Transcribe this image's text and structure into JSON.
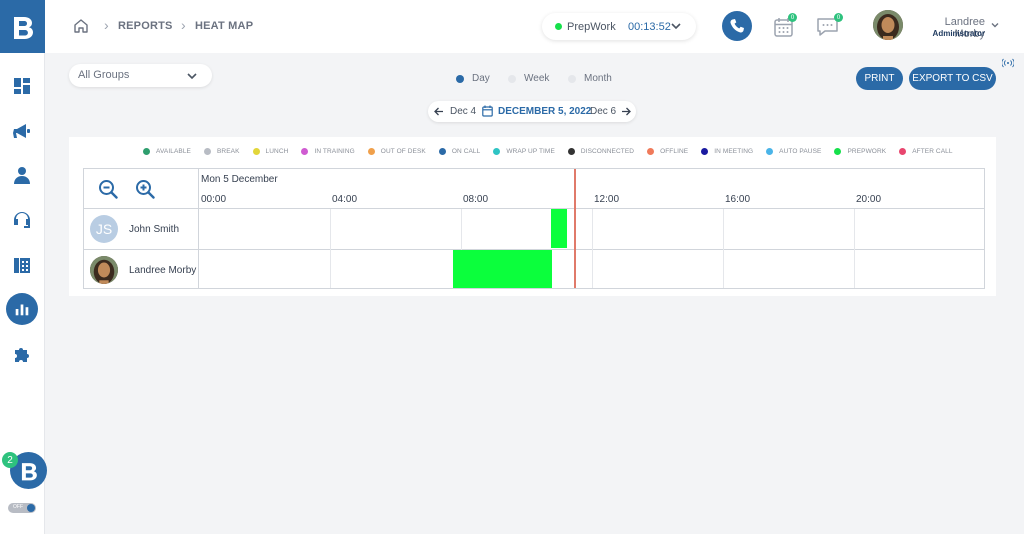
{
  "breadcrumb": {
    "items": [
      "REPORTS",
      "HEAT MAP"
    ]
  },
  "status": {
    "label": "PrepWork",
    "timer": "00:13:52",
    "color": "#16e04b"
  },
  "header": {
    "calendar_badge": "0",
    "chat_badge": "0",
    "user": {
      "name": "Landree Morby",
      "role": "Administrator"
    }
  },
  "sidebar": {
    "items": [
      "dashboard",
      "campaigns",
      "agents",
      "support",
      "phone-book",
      "reports",
      "integrations"
    ],
    "notification_count": "2",
    "toggle_label": "OFF"
  },
  "toolbar": {
    "group_select": "All Groups",
    "views": [
      {
        "label": "Day",
        "selected": true
      },
      {
        "label": "Week",
        "selected": false
      },
      {
        "label": "Month",
        "selected": false
      }
    ],
    "print_label": "PRINT",
    "export_label": "EXPORT TO CSV"
  },
  "date_nav": {
    "prev": "Dec 4",
    "current": "DECEMBER 5, 2022",
    "next": "Dec 6"
  },
  "legend": [
    {
      "label": "AVAILABLE",
      "color": "#2e9e6e"
    },
    {
      "label": "BREAK",
      "color": "#b8bcc4"
    },
    {
      "label": "LUNCH",
      "color": "#e2d63a"
    },
    {
      "label": "IN TRAINING",
      "color": "#cf5bd1"
    },
    {
      "label": "OUT OF DESK",
      "color": "#f0a04b"
    },
    {
      "label": "ON CALL",
      "color": "#2b6aa7"
    },
    {
      "label": "WRAP UP TIME",
      "color": "#2ec4c4"
    },
    {
      "label": "DISCONNECTED",
      "color": "#333333"
    },
    {
      "label": "OFFLINE",
      "color": "#f07a5a"
    },
    {
      "label": "IN MEETING",
      "color": "#1a1aa0"
    },
    {
      "label": "AUTO PAUSE",
      "color": "#4ab4e8"
    },
    {
      "label": "PREPWORK",
      "color": "#16e04b"
    },
    {
      "label": "AFTER CALL",
      "color": "#e8466e"
    }
  ],
  "heatmap": {
    "date_label": "Mon 5 December",
    "hours": [
      "00:00",
      "04:00",
      "08:00",
      "12:00",
      "16:00",
      "20:00"
    ],
    "agents": [
      {
        "name": "John Smith",
        "initials": "JS"
      },
      {
        "name": "Landree Morby"
      }
    ],
    "prepwork_color": "#0bff3c"
  }
}
